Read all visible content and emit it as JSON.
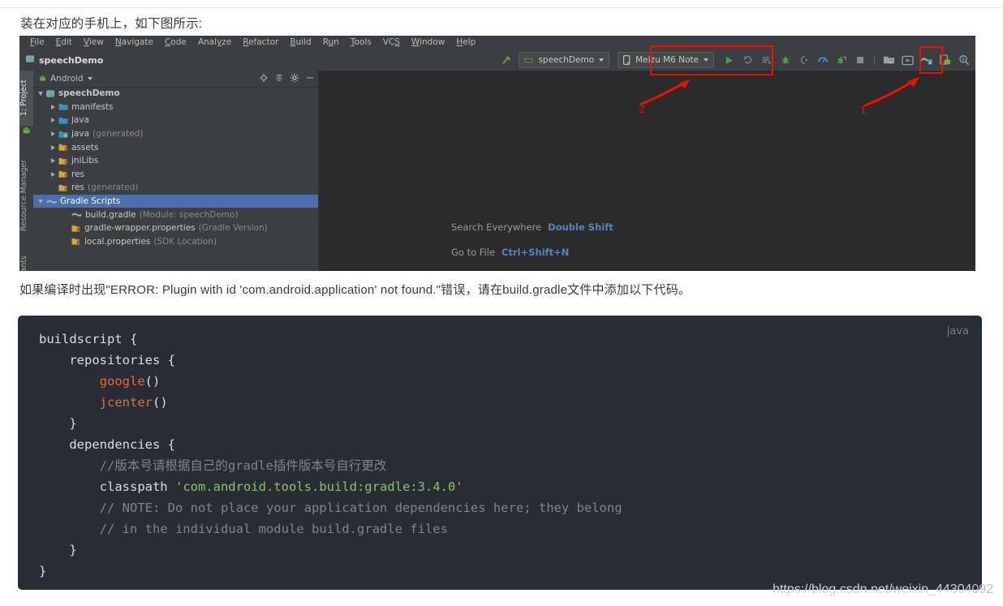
{
  "page": {
    "top_partial_text": "· · ·",
    "prose_line_1": "装在对应的手机上，如下图所示:",
    "prose_line_2": "如果编译时出现\"ERROR: Plugin with id 'com.android.application' not found.\"错误，请在build.gradle文件中添加以下代码。",
    "watermark": "https://blog.csdn.net/weixin_44304",
    "watermark_dim": "092"
  },
  "ide": {
    "menubar": [
      {
        "label": "File",
        "accel": "F"
      },
      {
        "label": "Edit",
        "accel": "E"
      },
      {
        "label": "View",
        "accel": "V"
      },
      {
        "label": "Navigate",
        "accel": "N"
      },
      {
        "label": "Code",
        "accel": "C"
      },
      {
        "label": "Analyze",
        "accel": "y"
      },
      {
        "label": "Refactor",
        "accel": "R"
      },
      {
        "label": "Build",
        "accel": "B"
      },
      {
        "label": "Run",
        "accel": "u"
      },
      {
        "label": "Tools",
        "accel": "T"
      },
      {
        "label": "VCS",
        "accel": "S"
      },
      {
        "label": "Window",
        "accel": "W"
      },
      {
        "label": "Help",
        "accel": "H"
      }
    ],
    "breadcrumb": "speechDemo",
    "toolbar": {
      "run_config": "speechDemo",
      "device": "Meizu M6 Note",
      "run_icon": "run-play-icon",
      "icons": [
        "apply-changes-icon",
        "apply-code-changes-icon",
        "debug-icon",
        "attach-debugger-icon",
        "profiler-icon",
        "run-with-coverage-icon",
        "stop-icon",
        "sdk-manager-icon",
        "avd-manager-icon",
        "device-file-explorer-icon",
        "layout-inspector-icon",
        "sync-gradle-icon"
      ]
    },
    "tool_windows": [
      {
        "label": "1: Project",
        "selected": true
      },
      {
        "label": "Resource Manager",
        "selected": false
      },
      {
        "label": "ariants",
        "selected": false
      }
    ],
    "project_panel": {
      "selector_label": "Android",
      "header_icons": [
        "locate-icon",
        "collapse-all-icon",
        "settings-gear-icon",
        "hide-icon"
      ],
      "tree": [
        {
          "indent": 0,
          "toggle": "down",
          "icon": "module-icon",
          "label": "speechDemo",
          "dim": "",
          "bold": true,
          "selected": false
        },
        {
          "indent": 1,
          "toggle": "right",
          "icon": "folder-icon",
          "label": "manifests",
          "dim": "",
          "bold": false,
          "selected": false
        },
        {
          "indent": 1,
          "toggle": "right",
          "icon": "folder-icon",
          "label": "java",
          "dim": "",
          "bold": false,
          "selected": false
        },
        {
          "indent": 1,
          "toggle": "right",
          "icon": "folder-gen-icon",
          "label": "java",
          "dim": "(generated)",
          "bold": false,
          "selected": false
        },
        {
          "indent": 1,
          "toggle": "right",
          "icon": "folder-res-icon",
          "label": "assets",
          "dim": "",
          "bold": false,
          "selected": false
        },
        {
          "indent": 1,
          "toggle": "right",
          "icon": "folder-res-icon",
          "label": "jniLibs",
          "dim": "",
          "bold": false,
          "selected": false
        },
        {
          "indent": 1,
          "toggle": "right",
          "icon": "folder-res-icon",
          "label": "res",
          "dim": "",
          "bold": false,
          "selected": false
        },
        {
          "indent": 1,
          "toggle": "none",
          "icon": "folder-res-icon",
          "label": "res",
          "dim": "(generated)",
          "bold": false,
          "selected": false
        },
        {
          "indent": 0,
          "toggle": "down",
          "icon": "gradle-icon",
          "label": "Gradle Scripts",
          "dim": "",
          "bold": false,
          "selected": true
        },
        {
          "indent": 2,
          "toggle": "none",
          "icon": "gradle-icon",
          "label": "build.gradle",
          "dim": "(Module: speechDemo)",
          "bold": false,
          "selected": false
        },
        {
          "indent": 2,
          "toggle": "none",
          "icon": "properties-icon",
          "label": "gradle-wrapper.properties",
          "dim": "(Gradle Version)",
          "bold": false,
          "selected": false
        },
        {
          "indent": 2,
          "toggle": "none",
          "icon": "properties-icon",
          "label": "local.properties",
          "dim": "(SDK Location)",
          "bold": false,
          "selected": false
        }
      ]
    },
    "editor_tips": [
      {
        "label": "Search Everywhere",
        "shortcut": "Double Shift"
      },
      {
        "label": "Go to File",
        "shortcut": "Ctrl+Shift+N"
      }
    ],
    "annotations": [
      {
        "name": "callout-2",
        "number": "2",
        "target": "device-dropdown"
      },
      {
        "name": "callout-1",
        "number": "1",
        "target": "sync-gradle-button"
      }
    ],
    "accent_color": "#f01000",
    "selection_color": "#4b6eaf"
  },
  "code_block": {
    "language": "java",
    "lines": [
      [
        {
          "t": "buildscript {",
          "c": "kw"
        }
      ],
      [
        {
          "t": "    repositories {",
          "c": "kw"
        }
      ],
      [
        {
          "t": "        ",
          "c": "kw"
        },
        {
          "t": "google",
          "c": "fn"
        },
        {
          "t": "()",
          "c": "kw"
        }
      ],
      [
        {
          "t": "        ",
          "c": "kw"
        },
        {
          "t": "jcenter",
          "c": "fn"
        },
        {
          "t": "()",
          "c": "kw"
        }
      ],
      [
        {
          "t": "    }",
          "c": "kw"
        }
      ],
      [
        {
          "t": "    dependencies {",
          "c": "kw"
        }
      ],
      [
        {
          "t": "        //版本号请根据自己的gradle插件版本号自行更改",
          "c": "cmt"
        }
      ],
      [
        {
          "t": "        classpath ",
          "c": "kw"
        },
        {
          "t": "'com.android.tools.build:gradle:3.4.0'",
          "c": "str"
        }
      ],
      [
        {
          "t": "        // NOTE: Do not place your application dependencies here; they belong",
          "c": "cmt"
        }
      ],
      [
        {
          "t": "        // in the individual module build.gradle files",
          "c": "cmt"
        }
      ],
      [
        {
          "t": "    }",
          "c": "kw"
        }
      ],
      [
        {
          "t": "}",
          "c": "kw"
        }
      ]
    ]
  }
}
